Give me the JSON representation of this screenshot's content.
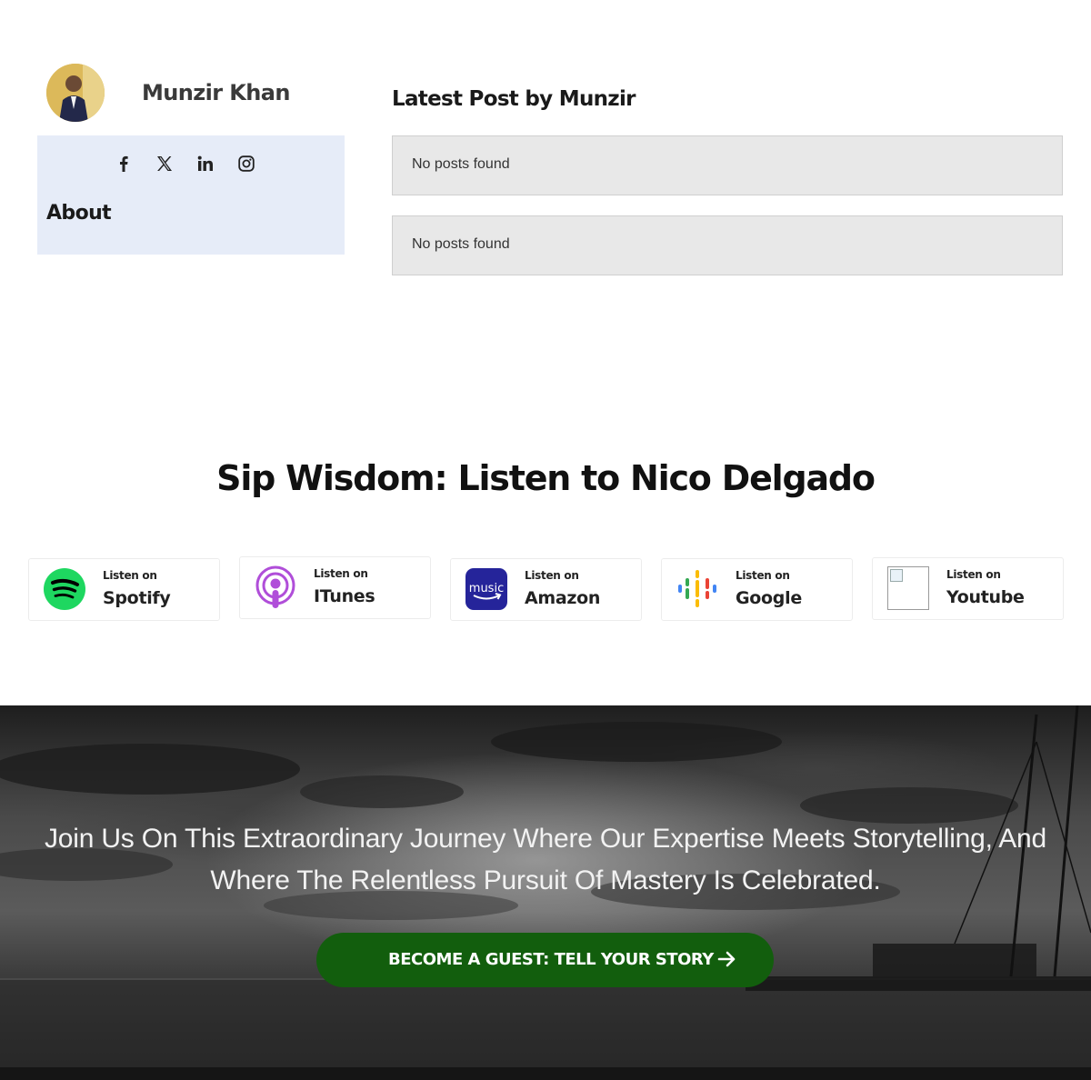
{
  "author": {
    "name": "Munzir Khan",
    "about_title": "About",
    "socials": [
      {
        "icon": "facebook-icon"
      },
      {
        "icon": "x-twitter-icon"
      },
      {
        "icon": "linkedin-icon"
      },
      {
        "icon": "instagram-icon"
      }
    ]
  },
  "latest": {
    "title": "Latest Post by Munzir",
    "posts": [
      {
        "text": "No posts found"
      },
      {
        "text": "No posts found"
      }
    ]
  },
  "listen": {
    "heading": "Sip Wisdom: Listen to Nico Delgado",
    "platforms": [
      {
        "small": "Listen on",
        "name": "Spotify",
        "icon": "spotify-icon",
        "color": "#1ed760"
      },
      {
        "small": "Listen on",
        "name": "ITunes",
        "icon": "apple-podcasts-icon",
        "color": "#b04ed9"
      },
      {
        "small": "Listen on",
        "name": "Amazon",
        "icon": "amazon-music-icon",
        "color": "#25249a"
      },
      {
        "small": "Listen on",
        "name": "Google",
        "icon": "google-podcasts-icon",
        "color": "#4285f4"
      },
      {
        "small": "Listen on",
        "name": "Youtube",
        "icon": "broken-image-icon"
      }
    ]
  },
  "cta": {
    "text": "Join Us On This Extraordinary Journey Where Our Expertise Meets Storytelling, And Where The Relentless Pursuit Of Mastery Is Celebrated.",
    "button_label": "BECOME A GUEST: TELL YOUR STORY",
    "button_color": "#125e0d"
  }
}
